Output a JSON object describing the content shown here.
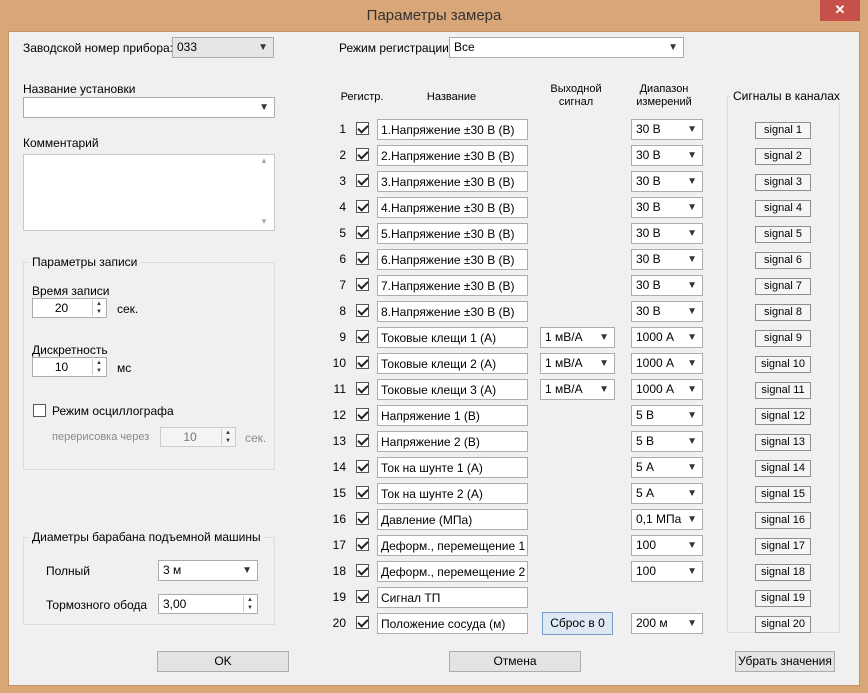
{
  "window": {
    "title": "Параметры замера",
    "close_icon": "close-icon"
  },
  "left": {
    "serial_label": "Заводской номер прибора:",
    "serial_value": "033",
    "install_label": "Название установки",
    "install_value": "",
    "comment_label": "Комментарий",
    "comment_value": "",
    "rec_group": {
      "title": "Параметры записи",
      "time_label": "Время записи",
      "time_value": "20",
      "time_unit": "сек.",
      "disc_label": "Дискретность",
      "disc_value": "10",
      "disc_unit": "мс",
      "osc_label": "Режим осциллографа",
      "osc_checked": false,
      "redraw_label": "перерисовка через",
      "redraw_value": "10",
      "redraw_unit": "сек."
    },
    "drum_group": {
      "title": "Диаметры барабана подъемной машины",
      "full_label": "Полный",
      "full_value": "3 м",
      "brake_label": "Тормозного обода",
      "brake_value": "3,00"
    }
  },
  "mode": {
    "label": "Режим регистрации",
    "value": "Все"
  },
  "table": {
    "headers": {
      "reg": "Регистр.",
      "name": "Название",
      "output": "Выходной\nсигнал",
      "range": "Диапазон\nизмерений"
    },
    "rows": [
      {
        "num": "1",
        "checked": true,
        "name": "1.Напряжение ±30 В (В)",
        "output": "",
        "range": "30 В"
      },
      {
        "num": "2",
        "checked": true,
        "name": "2.Напряжение ±30 В (В)",
        "output": "",
        "range": "30 В"
      },
      {
        "num": "3",
        "checked": true,
        "name": "3.Напряжение ±30 В (В)",
        "output": "",
        "range": "30 В"
      },
      {
        "num": "4",
        "checked": true,
        "name": "4.Напряжение ±30 В (В)",
        "output": "",
        "range": "30 В"
      },
      {
        "num": "5",
        "checked": true,
        "name": "5.Напряжение ±30 В (В)",
        "output": "",
        "range": "30 В"
      },
      {
        "num": "6",
        "checked": true,
        "name": "6.Напряжение ±30 В (В)",
        "output": "",
        "range": "30 В"
      },
      {
        "num": "7",
        "checked": true,
        "name": "7.Напряжение ±30 В (В)",
        "output": "",
        "range": "30 В"
      },
      {
        "num": "8",
        "checked": true,
        "name": "8.Напряжение ±30 В (В)",
        "output": "",
        "range": "30 В"
      },
      {
        "num": "9",
        "checked": true,
        "name": "Токовые клещи 1 (А)",
        "output": "1 мВ/А",
        "range": "1000 А"
      },
      {
        "num": "10",
        "checked": true,
        "name": "Токовые клещи 2 (А)",
        "output": "1 мВ/А",
        "range": "1000 А"
      },
      {
        "num": "11",
        "checked": true,
        "name": "Токовые клещи 3 (А)",
        "output": "1 мВ/А",
        "range": "1000 А"
      },
      {
        "num": "12",
        "checked": true,
        "name": "Напряжение 1 (В)",
        "output": "",
        "range": "5 В"
      },
      {
        "num": "13",
        "checked": true,
        "name": "Напряжение 2 (В)",
        "output": "",
        "range": "5 В"
      },
      {
        "num": "14",
        "checked": true,
        "name": "Ток на шунте 1 (А)",
        "output": "",
        "range": "5 А"
      },
      {
        "num": "15",
        "checked": true,
        "name": "Ток на шунте 2 (А)",
        "output": "",
        "range": "5 А"
      },
      {
        "num": "16",
        "checked": true,
        "name": "Давление (МПа)",
        "output": "",
        "range": "0,1 МПа"
      },
      {
        "num": "17",
        "checked": true,
        "name": "Деформ., перемещение 1",
        "output": "",
        "range": "100"
      },
      {
        "num": "18",
        "checked": true,
        "name": "Деформ., перемещение 2",
        "output": "",
        "range": "100"
      },
      {
        "num": "19",
        "checked": true,
        "name": "Сигнал ТП",
        "output": "",
        "range": ""
      },
      {
        "num": "20",
        "checked": true,
        "name": "Положение сосуда (м)",
        "output": "Сброс в 0",
        "range": "200 м"
      }
    ]
  },
  "signals": {
    "title": "Сигналы в каналах",
    "items": [
      "signal 1",
      "signal 2",
      "signal 3",
      "signal 4",
      "signal 5",
      "signal 6",
      "signal 7",
      "signal 8",
      "signal 9",
      "signal 10",
      "signal 11",
      "signal 12",
      "signal 13",
      "signal 14",
      "signal 15",
      "signal 16",
      "signal 17",
      "signal 18",
      "signal 19",
      "signal 20"
    ]
  },
  "buttons": {
    "ok": "OK",
    "cancel": "Отмена",
    "clear": "Убрать значения"
  }
}
